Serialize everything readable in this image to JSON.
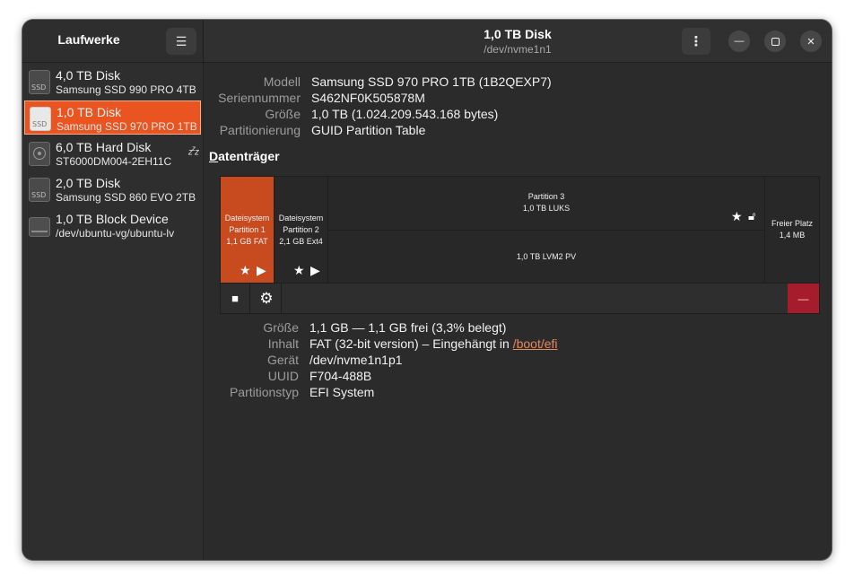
{
  "sidebar": {
    "title": "Laufwerke",
    "menu_icon": "hamburger-icon",
    "devices": [
      {
        "name": "4,0 TB Disk",
        "sub": "Samsung SSD 990 PRO 4TB",
        "icon": "ssd-icon",
        "icon_text": "SSD",
        "selected": false
      },
      {
        "name": "1,0 TB Disk",
        "sub": "Samsung SSD 970 PRO 1TB",
        "icon": "ssd-icon",
        "icon_text": "SSD",
        "selected": true
      },
      {
        "name": "6,0 TB Hard Disk",
        "sub": "ST6000DM004-2EH11C",
        "icon": "hdd-icon",
        "selected": false,
        "status_icon": "sleep-icon"
      },
      {
        "name": "2,0 TB Disk",
        "sub": "Samsung SSD 860 EVO 2TB",
        "icon": "ssd-icon",
        "icon_text": "SSD",
        "selected": false
      },
      {
        "name": "1,0 TB Block Device",
        "sub": "/dev/ubuntu-vg/ubuntu-lv",
        "icon": "block-device-icon",
        "selected": false
      }
    ]
  },
  "header": {
    "title": "1,0 TB Disk",
    "subtitle": "/dev/nvme1n1",
    "kebab": "⋮",
    "minimize": "—",
    "maximize": "▢",
    "close": "✕"
  },
  "disk_info": {
    "rows": [
      {
        "key": "Modell",
        "value": "Samsung SSD 970 PRO 1TB (1B2QEXP7)"
      },
      {
        "key": "Seriennummer",
        "value": "S462NF0K505878M"
      },
      {
        "key": "Größe",
        "value": "1,0 TB (1.024.209.543.168 bytes)"
      },
      {
        "key": "Partitionierung",
        "value": "GUID Partition Table"
      }
    ]
  },
  "volumes": {
    "title_first": "D",
    "title_rest": "atenträger",
    "partitions": [
      {
        "line1": "Dateisystem",
        "line2": "Partition 1",
        "line3": "1,1 GB FAT",
        "selected": true
      },
      {
        "line1": "Dateisystem",
        "line2": "Partition 2",
        "line3": "2,1 GB Ext4",
        "selected": false
      },
      {
        "line1": "Partition 3",
        "line2": "1,0 TB LUKS",
        "inner": "1,0 TB LVM2 PV",
        "selected": false
      },
      {
        "line1": "Freier Platz",
        "line2": "1,4 MB",
        "selected": false
      }
    ],
    "toolbar": {
      "stop": "■",
      "gear": "⚙",
      "delete": "—"
    }
  },
  "partition_info": {
    "rows": [
      {
        "key": "Größe",
        "value": "1,1 GB — 1,1 GB frei (3,3% belegt)"
      },
      {
        "key": "Inhalt",
        "value": "FAT (32-bit version) – Eingehängt in ",
        "link": "/boot/efi"
      },
      {
        "key": "Gerät",
        "value": "/dev/nvme1n1p1"
      },
      {
        "key": "UUID",
        "value": "F704-488B"
      },
      {
        "key": "Partitionstyp",
        "value": "EFI System"
      }
    ]
  },
  "colors": {
    "accent": "#e95420",
    "selected_partition": "#c84a1f",
    "destructive": "#a51d2d",
    "link": "#e7885d"
  }
}
